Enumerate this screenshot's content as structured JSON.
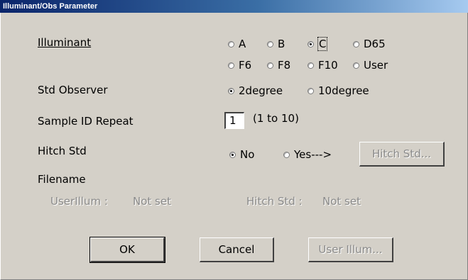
{
  "window": {
    "title": "Illuminant/Obs Parameter"
  },
  "labels": {
    "illuminant": "Illuminant",
    "std_observer": "Std Observer",
    "sample_id_repeat": "Sample ID Repeat",
    "hitch_std": "Hitch Std",
    "filename": "Filename"
  },
  "illuminant_options": [
    {
      "label": "A",
      "selected": false
    },
    {
      "label": "B",
      "selected": false
    },
    {
      "label": "C",
      "selected": true
    },
    {
      "label": "D65",
      "selected": false
    },
    {
      "label": "F6",
      "selected": false
    },
    {
      "label": "F8",
      "selected": false
    },
    {
      "label": "F10",
      "selected": false
    },
    {
      "label": "User",
      "selected": false
    }
  ],
  "observer_options": [
    {
      "label": "2degree",
      "selected": true
    },
    {
      "label": "10degree",
      "selected": false
    }
  ],
  "sample_id": {
    "value": "1",
    "range": "(1 to 10)"
  },
  "hitch_options": [
    {
      "label": "No",
      "selected": true
    },
    {
      "label": "Yes--->",
      "selected": false
    }
  ],
  "hitch_std_button": "Hitch Std...",
  "file_info": {
    "user_illum_label": "UserIllum :",
    "user_illum_value": "Not set",
    "hitch_std_label": "Hitch Std :",
    "hitch_std_value": "Not set"
  },
  "buttons": {
    "ok": "OK",
    "cancel": "Cancel",
    "user_illum": "User Illum..."
  }
}
